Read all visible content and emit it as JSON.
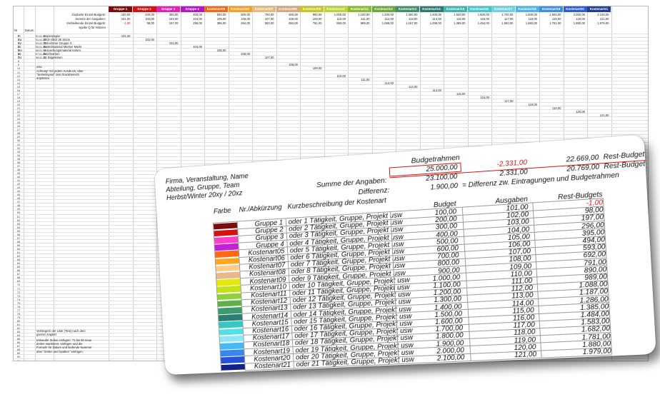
{
  "sheet": {
    "summary_labels": [
      "Geplante Einzel-Budgets:",
      "Summe der Ausgaben:",
      "Verbleibende Einzel-Budgets:",
      "Spalte Q für Notizen"
    ],
    "col_labels": [
      "Nr",
      "Datum"
    ],
    "headers": [
      {
        "label": "Gruppe 1",
        "color": "#7b0d0d"
      },
      {
        "label": "Gruppe 2",
        "color": "#d41212"
      },
      {
        "label": "Gruppe 3",
        "color": "#e81fb6"
      },
      {
        "label": "Gruppe 4",
        "color": "#b317c8"
      },
      {
        "label": "Kostenart05",
        "color": "#f06a14"
      },
      {
        "label": "Kostenart06",
        "color": "#f4a020"
      },
      {
        "label": "Kostenart07",
        "color": "#e9b97a"
      },
      {
        "label": "Kostenart08",
        "color": "#d8a77d"
      },
      {
        "label": "Kostenart09",
        "color": "#c8c818"
      },
      {
        "label": "Kostenart10",
        "color": "#b8d62b"
      },
      {
        "label": "Kostenart11",
        "color": "#8abd2b"
      },
      {
        "label": "Kostenart12",
        "color": "#6aa83a"
      },
      {
        "label": "Kostenart13",
        "color": "#3f8f6a"
      },
      {
        "label": "Kostenart14",
        "color": "#2f7a6e"
      },
      {
        "label": "Kostenart15",
        "color": "#3eb6b0"
      },
      {
        "label": "Kostenart16",
        "color": "#46c6cf"
      },
      {
        "label": "Kostenart17",
        "color": "#6cd2e6"
      },
      {
        "label": "Kostenart18",
        "color": "#4bb4e8"
      },
      {
        "label": "Kostenart19",
        "color": "#3f8fe0"
      },
      {
        "label": "Kostenart20",
        "color": "#2d5fd0"
      },
      {
        "label": "Kostenart21",
        "color": "#1f3f8f"
      }
    ],
    "planned": [
      "100,00",
      "200,00",
      "300,00",
      "400,00",
      "500,00",
      "600,00",
      "700,00",
      "800,00",
      "900,00",
      "1.000,00",
      "1.100,00",
      "1.200,00",
      "1.300,00",
      "1.400,00",
      "1.500,00",
      "1.600,00",
      "1.700,00",
      "1.800,00",
      "1.900,00",
      "2.000,00",
      "2.100,00"
    ],
    "spent": [
      "101,00",
      "102,00",
      "103,00",
      "104,00",
      "105,00",
      "106,00",
      "107,00",
      "108,00",
      "109,00",
      "110,00",
      "111,00",
      "112,00",
      "113,00",
      "114,00",
      "115,00",
      "116,00",
      "117,00",
      "118,00",
      "119,00",
      "120,00",
      "121,00"
    ],
    "remaining": [
      "-1,00",
      "98,00",
      "197,00",
      "296,00",
      "395,00",
      "494,00",
      "593,00",
      "692,00",
      "791,00",
      "890,00",
      "989,00",
      "1.088,00",
      "1.187,00",
      "1.286,00",
      "1.385,00",
      "1.484,00",
      "1.583,00",
      "1.682,00",
      "1.781,00",
      "1.880,00",
      "1.979,00"
    ],
    "rows": [
      {
        "nr": "Fr",
        "date": "01.01.20",
        "text": "Kopierpapier"
      },
      {
        "nr": "Sa",
        "date": "01.01.20",
        "text": "Glüh-Stick 2€ Stück"
      },
      {
        "nr": "So",
        "date": "03.01.20",
        "text": "Teilnehmer Gruppe 3"
      },
      {
        "nr": "Di",
        "date": "05.01.20",
        "text": "Bastelmaterial Meister Markt"
      },
      {
        "nr": "Mo",
        "date": "06.01.20",
        "text": "Verpackungsmaterial Kisten"
      },
      {
        "nr": "Mi",
        "date": "07.01.20",
        "text": "Briefmarken"
      },
      {
        "nr": "Do",
        "date": "08.01.20",
        "text": "21 Bügeleisen"
      }
    ],
    "notes": [
      "usw.",
      "Achtung! Vor jedem Ausdruck, über \"Seitenlayout\" den Druckbereich anpassen.",
      "Verlängern der Liste (Test) nach dem ganzen Kapitel",
      "Entweder Zeilen einfügen: 71 bis 90 neue Zeilen markieren, einfügen und die Formeln für Datum und laufende Nummer über \"Zeilen und Spalten\" einfügen."
    ]
  },
  "zoom": {
    "company": [
      "Firma, Veranstaltung, Name",
      "Abteilung, Gruppe, Team",
      "Herbst/Winter 20xy / 20xz"
    ],
    "budgetrahmen_label": "Budgetrahmen",
    "summe_label": "Summe der Angaben:",
    "differenz_label": "Differenz:",
    "budget_total": "25.000,00",
    "budget_used": "23.100,00",
    "diff_value": "1.900,00",
    "diff_text": "= Differenz zw. Eintragungen und Budgetrahmen",
    "rest_neg": "-2.331,00",
    "rest_pos": "2.331,00",
    "rest_plan_val": "22.669,00",
    "rest_plan_label": "Rest-Budget plan",
    "rest_ist_val": "20.769,00",
    "rest_ist_label": "Rest-Budget ist",
    "col_headers": [
      "Farbe",
      "Nr./Abkürzung",
      "Kurzbeschreibung der Kostenart",
      "Budget",
      "Ausgaben",
      "Rest-Budgets"
    ],
    "rows": [
      {
        "name": "Gruppe 1",
        "desc": "oder 1  Tätigkeit, Gruppe, Projekt usw",
        "budget": "100,00",
        "spent": "101,00",
        "rest": "-1,00",
        "color": "#7b0d0d"
      },
      {
        "name": "Gruppe 2",
        "desc": "oder 2  Tätigkeit, Gruppe, Projekt usw",
        "budget": "200,00",
        "spent": "102,00",
        "rest": "98,00",
        "color": "#d41212"
      },
      {
        "name": "Gruppe 3",
        "desc": "oder 3  Tätigkeit, Gruppe, Projekt usw",
        "budget": "300,00",
        "spent": "103,00",
        "rest": "197,00",
        "color": "#ff3fc8"
      },
      {
        "name": "Gruppe 4",
        "desc": "oder 4  Tätigkeit, Gruppe, Projekt usw",
        "budget": "400,00",
        "spent": "104,00",
        "rest": "296,00",
        "color": "#c31fd8"
      },
      {
        "name": "Kostenart05",
        "desc": "oder 5  Tätigkeit, Gruppe, Projekt usw",
        "budget": "500,00",
        "spent": "105,00",
        "rest": "395,00",
        "color": "#ff6a10"
      },
      {
        "name": "Kostenart06",
        "desc": "oder 6  Tätigkeit, Gruppe, Projekt usw",
        "budget": "600,00",
        "spent": "106,00",
        "rest": "494,00",
        "color": "#ffa51f"
      },
      {
        "name": "Kostenart07",
        "desc": "oder 7  Tätigkeit, Gruppe, Projekt usw",
        "budget": "700,00",
        "spent": "107,00",
        "rest": "593,00",
        "color": "#ffcc8a"
      },
      {
        "name": "Kostenart08",
        "desc": "oder 8  Tätigkeit, Gruppe, Projekt usw",
        "budget": "800,00",
        "spent": "108,00",
        "rest": "692,00",
        "color": "#e8b890"
      },
      {
        "name": "Kostenart09",
        "desc": "oder 9  Tätigkeit, Gruppe, Projekt usw",
        "budget": "900,00",
        "spent": "109,00",
        "rest": "791,00",
        "color": "#e6e60f"
      },
      {
        "name": "Kostenart10",
        "desc": "oder 10  Tätigkeit, Gruppe, Projekt usw",
        "budget": "1.000,00",
        "spent": "110,00",
        "rest": "890,00",
        "color": "#c4e21a"
      },
      {
        "name": "Kostenart11",
        "desc": "oder 11  Tätigkeit, Gruppe, Projekt usw",
        "budget": "1.100,00",
        "spent": "111,00",
        "rest": "989,00",
        "color": "#8fd13a"
      },
      {
        "name": "Kostenart12",
        "desc": "oder 12  Tätigkeit, Gruppe, Projekt usw",
        "budget": "1.200,00",
        "spent": "112,00",
        "rest": "1.088,00",
        "color": "#5fb04a"
      },
      {
        "name": "Kostenart13",
        "desc": "oder 13  Tätigkeit, Gruppe, Projekt usw",
        "budget": "1.300,00",
        "spent": "113,00",
        "rest": "1.187,00",
        "color": "#3c9a6e"
      },
      {
        "name": "Kostenart14",
        "desc": "oder 14  Tätigkeit, Gruppe, Projekt usw",
        "budget": "1.400,00",
        "spent": "114,00",
        "rest": "1.286,00",
        "color": "#2a7e74"
      },
      {
        "name": "Kostenart15",
        "desc": "oder 15  Tätigkeit, Gruppe, Projekt usw",
        "budget": "1.500,00",
        "spent": "115,00",
        "rest": "1.385,00",
        "color": "#35c8c2"
      },
      {
        "name": "Kostenart16",
        "desc": "oder 16  Tätigkeit, Gruppe, Projekt usw",
        "budget": "1.600,00",
        "spent": "116,00",
        "rest": "1.484,00",
        "color": "#4fe0e8"
      },
      {
        "name": "Kostenart17",
        "desc": "oder 17  Tätigkeit, Gruppe, Projekt usw",
        "budget": "1.700,00",
        "spent": "117,00",
        "rest": "1.583,00",
        "color": "#8ee8f4"
      },
      {
        "name": "Kostenart18",
        "desc": "oder 18  Tätigkeit, Gruppe, Projekt usw",
        "budget": "1.800,00",
        "spent": "118,00",
        "rest": "1.682,00",
        "color": "#46b8f4"
      },
      {
        "name": "Kostenart19",
        "desc": "oder 19  Tätigkeit, Gruppe, Projekt usw",
        "budget": "1.900,00",
        "spent": "119,00",
        "rest": "1.781,00",
        "color": "#3b86ea"
      },
      {
        "name": "Kostenart20",
        "desc": "oder 20  Tätigkeit, Gruppe, Projekt usw",
        "budget": "2.000,00",
        "spent": "120,00",
        "rest": "1.880,00",
        "color": "#2752d6"
      },
      {
        "name": "Kostenart21",
        "desc": "oder 21  Tätigkeit, Gruppe, Projekt usw",
        "budget": "2.100,00",
        "spent": "121,00",
        "rest": "1.979,00",
        "color": "#12208a"
      }
    ]
  }
}
